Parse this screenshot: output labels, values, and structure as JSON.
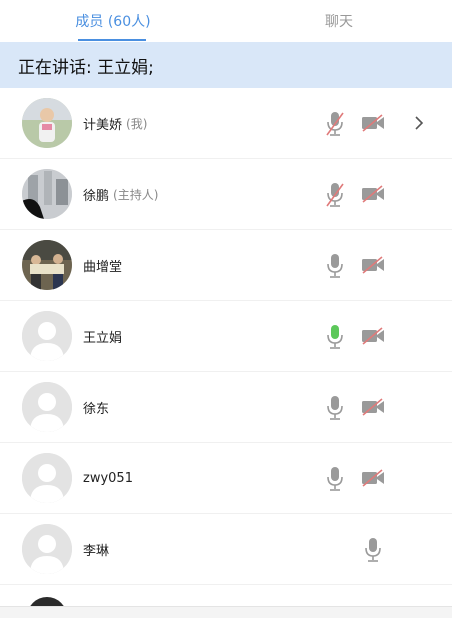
{
  "tabs": {
    "members_label": "成员 (60人)",
    "chat_label": "聊天"
  },
  "banner": {
    "text": "正在讲话: 王立娟;"
  },
  "members": [
    {
      "name": "计美娇",
      "role": "(我)",
      "mic": "muted",
      "camera": "off",
      "avatar": "photo-child",
      "has_detail": true
    },
    {
      "name": "徐鹏",
      "role": "(主持人)",
      "mic": "muted",
      "camera": "off",
      "avatar": "photo-buildings",
      "has_detail": false
    },
    {
      "name": "曲增堂",
      "role": "",
      "mic": "on",
      "camera": "off",
      "avatar": "photo-group",
      "has_detail": false
    },
    {
      "name": "王立娟",
      "role": "",
      "mic": "speaking",
      "camera": "off",
      "avatar": "default",
      "has_detail": false
    },
    {
      "name": "徐东",
      "role": "",
      "mic": "on",
      "camera": "off",
      "avatar": "default",
      "has_detail": false
    },
    {
      "name": "zwy051",
      "role": "",
      "mic": "on",
      "camera": "off",
      "avatar": "default",
      "has_detail": false
    },
    {
      "name": "李琳",
      "role": "",
      "mic": "on",
      "camera": "none",
      "avatar": "default",
      "has_detail": false
    }
  ],
  "colors": {
    "accent": "#4a8fe0",
    "banner_bg": "#d9e7f8",
    "icon_gray": "#9a9a9a",
    "muted_slash": "#e07a7a",
    "speaking_green": "#5cc85a"
  }
}
